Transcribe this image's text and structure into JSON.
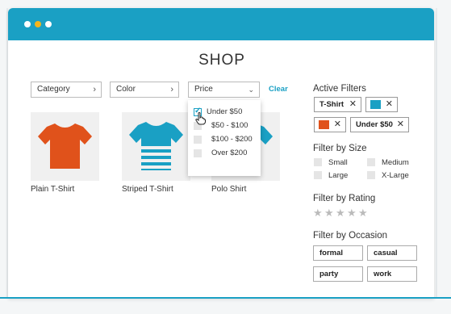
{
  "header": {
    "title": "SHOP"
  },
  "filters": {
    "category_label": "Category",
    "color_label": "Color",
    "price_label": "Price",
    "clear_label": "Clear"
  },
  "price_dropdown": {
    "options": [
      {
        "label": "Under $50",
        "checked": true
      },
      {
        "label": "$50 - $100",
        "checked": false
      },
      {
        "label": "$100 - $200",
        "checked": false
      },
      {
        "label": "Over $200",
        "checked": false
      }
    ]
  },
  "products": [
    {
      "name": "Plain T-Shirt",
      "color": "#e0521b"
    },
    {
      "name": "Striped T-Shirt",
      "color": "#1aa0c4"
    },
    {
      "name": "Polo Shirt",
      "color": "#1aa0c4"
    }
  ],
  "sidebar": {
    "active_filters_title": "Active Filters",
    "active_filters": [
      {
        "label": "T-Shirt"
      },
      {
        "swatch": "#1aa0c4"
      },
      {
        "swatch": "#e0521b"
      },
      {
        "label": "Under $50"
      }
    ],
    "size_title": "Filter by Size",
    "sizes": [
      "Small",
      "Medium",
      "Large",
      "X-Large"
    ],
    "rating_title": "Filter by Rating",
    "rating_stars": 5,
    "occasion_title": "Filter by Occasion",
    "occasions": [
      "formal",
      "casual",
      "party",
      "work"
    ]
  },
  "colors": {
    "accent": "#1aa0c4",
    "orange": "#e0521b",
    "yellow": "#f4b41a"
  }
}
